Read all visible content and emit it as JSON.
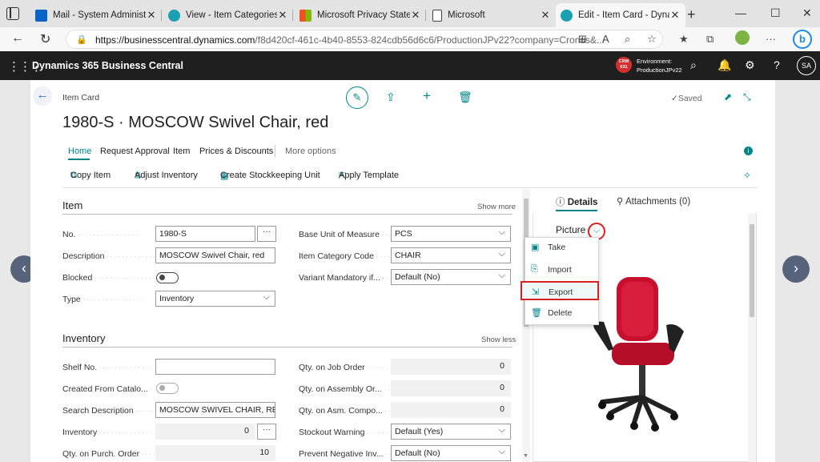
{
  "browser": {
    "tabs": [
      {
        "title": "Mail - System Administrat",
        "icon": "outlook-icon"
      },
      {
        "title": "View - Item Categories - D",
        "icon": "bc-icon"
      },
      {
        "title": "Microsoft Privacy Stateme",
        "icon": "microsoft-icon"
      },
      {
        "title": "Microsoft",
        "icon": "page-icon"
      },
      {
        "title": "Edit - Item Card - Dynamic",
        "icon": "bc-icon",
        "active": true
      }
    ],
    "url_host": "https://businesscentral.dynamics.com",
    "url_path": "/f8d420cf-461c-4b40-8553-824cdb56d6c6/ProductionJPv22?company=Cronus&..."
  },
  "appbar": {
    "title": "Dynamics 365 Business Central",
    "badge": "CRM 631",
    "env_label": "Environment:",
    "env_value": "ProductionJPv22",
    "avatar": "SA"
  },
  "header": {
    "breadcrumb": "Item Card",
    "title": "1980-S · MOSCOW Swivel Chair, red",
    "status": "Saved"
  },
  "menu": {
    "items": [
      "Home",
      "Request Approval",
      "Item",
      "Prices & Discounts"
    ],
    "more": "More options"
  },
  "actions": [
    "Copy Item",
    "Adjust Inventory",
    "Create Stockkeeping Unit",
    "Apply Template"
  ],
  "item_section": {
    "title": "Item",
    "show": "Show more",
    "no_label": "No.",
    "no_value": "1980-S",
    "desc_label": "Description",
    "desc_value": "MOSCOW Swivel Chair, red",
    "blocked_label": "Blocked",
    "type_label": "Type",
    "type_value": "Inventory",
    "uom_label": "Base Unit of Measure",
    "uom_value": "PCS",
    "cat_label": "Item Category Code",
    "cat_value": "CHAIR",
    "variant_label": "Variant Mandatory if...",
    "variant_value": "Default (No)"
  },
  "inventory_section": {
    "title": "Inventory",
    "show": "Show less",
    "shelf_label": "Shelf No.",
    "shelf_value": "",
    "catalog_label": "Created From Catalo...",
    "search_label": "Search Description",
    "search_value": "MOSCOW SWIVEL CHAIR, RED",
    "inv_label": "Inventory",
    "inv_value": "0",
    "purch_label": "Qty. on Purch. Order",
    "purch_value": "10",
    "job_label": "Qty. on Job Order",
    "job_value": "0",
    "asm_order_label": "Qty. on Assembly Or...",
    "asm_order_value": "0",
    "asm_comp_label": "Qty. on Asm. Compo...",
    "asm_comp_value": "0",
    "stockout_label": "Stockout Warning",
    "stockout_value": "Default (Yes)",
    "prevent_label": "Prevent Negative Inv...",
    "prevent_value": "Default (No)"
  },
  "factbox": {
    "details_tab": "Details",
    "attachments_tab": "Attachments (0)",
    "picture_title": "Picture",
    "menu": [
      "Take",
      "Import",
      "Export",
      "Delete"
    ]
  },
  "colors": {
    "accent": "#008489",
    "appbar": "#1f1f1f",
    "highlight": "#d92020",
    "chair": "#c8102e"
  }
}
